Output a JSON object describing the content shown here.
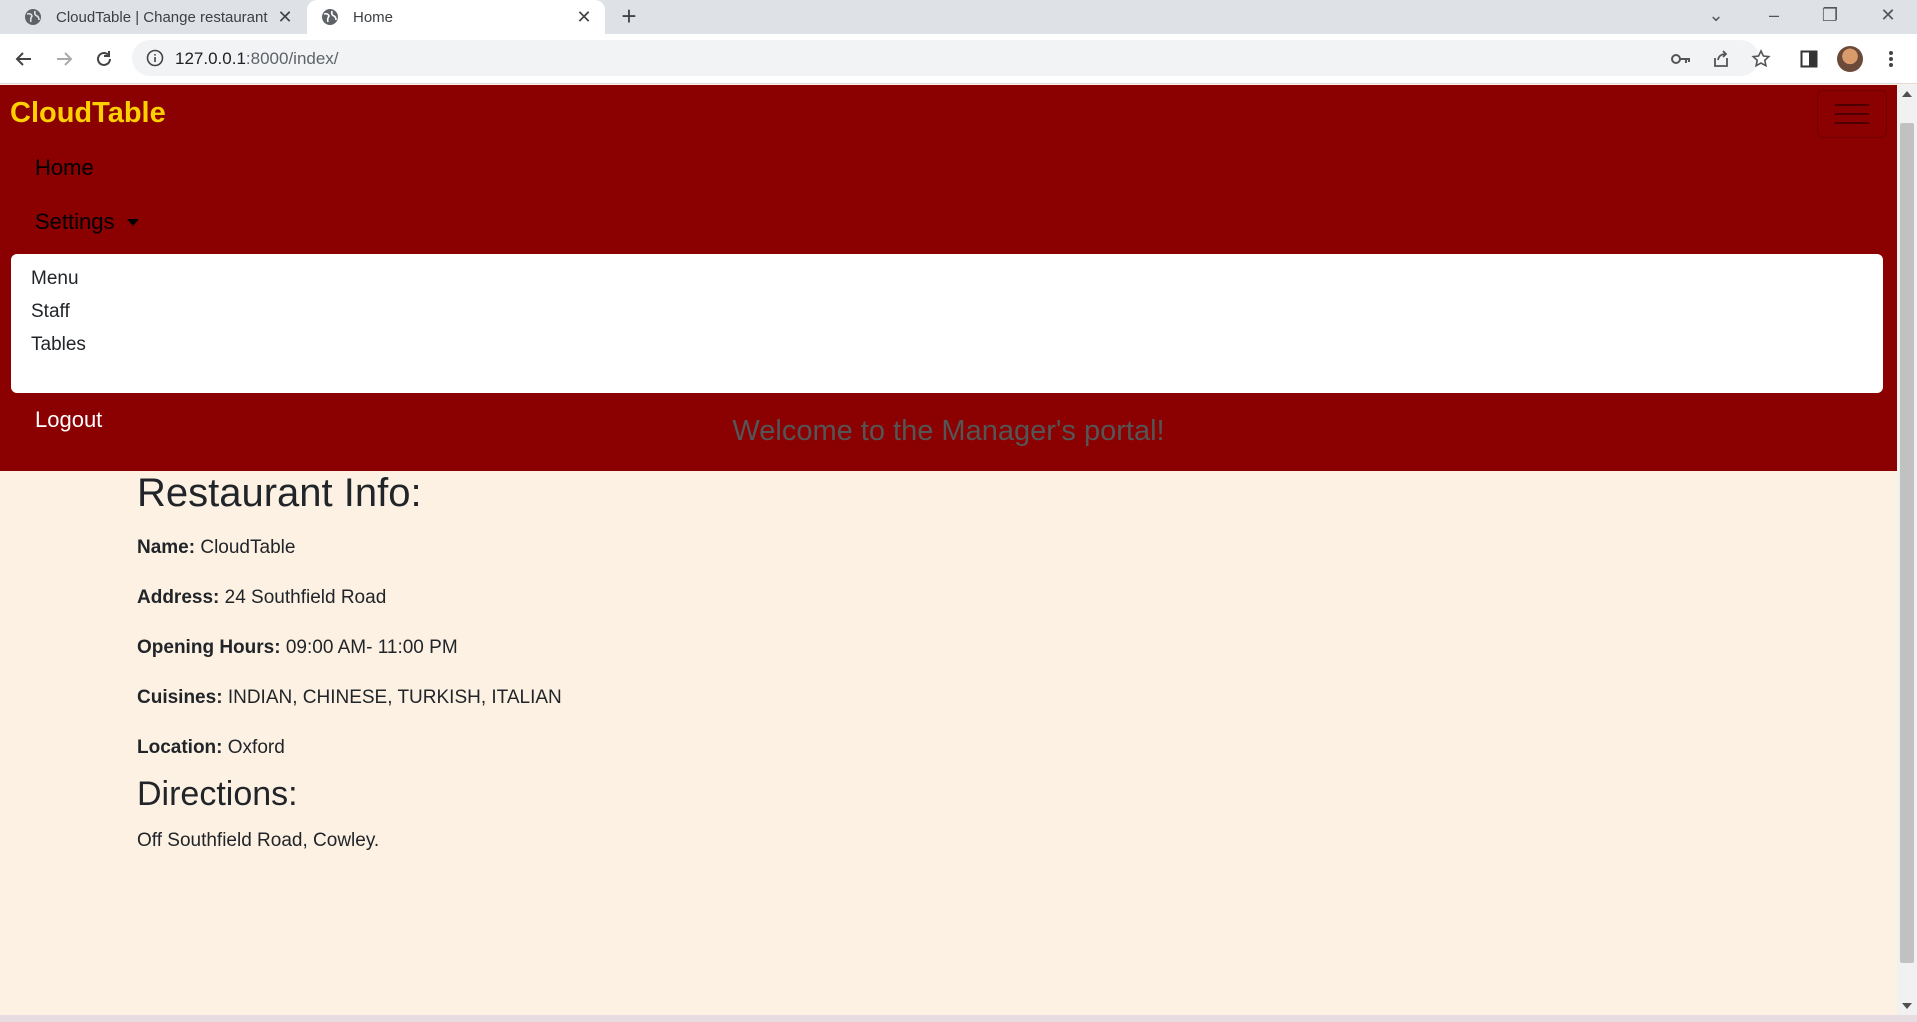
{
  "browser": {
    "tabs": [
      {
        "label": "CloudTable | Change restaurant |",
        "active": false
      },
      {
        "label": "Home",
        "active": true
      }
    ],
    "address": {
      "host": "127.0.0.1",
      "rest": ":8000/index/"
    }
  },
  "navbar": {
    "brand": "CloudTable",
    "links": {
      "home": "Home",
      "settings": "Settings",
      "logout": "Logout"
    },
    "dropdown": [
      "Menu",
      "Staff",
      "Tables"
    ]
  },
  "main": {
    "welcome": "Welcome to the Manager's portal!",
    "info_heading": "Restaurant Info:",
    "fields": [
      {
        "label": "Name:",
        "value": "CloudTable"
      },
      {
        "label": "Address:",
        "value": "24 Southfield Road"
      },
      {
        "label": "Opening Hours:",
        "value": "09:00 AM- 11:00 PM"
      },
      {
        "label": "Cuisines:",
        "value": "INDIAN, CHINESE, TURKISH, ITALIAN"
      },
      {
        "label": "Location:",
        "value": "Oxford"
      }
    ],
    "directions_heading": "Directions:",
    "directions": "Off Southfield Road, Cowley."
  },
  "colors": {
    "navbar": "#8b0000",
    "brand": "#ffd000",
    "page_bg": "#fdf1e3"
  }
}
